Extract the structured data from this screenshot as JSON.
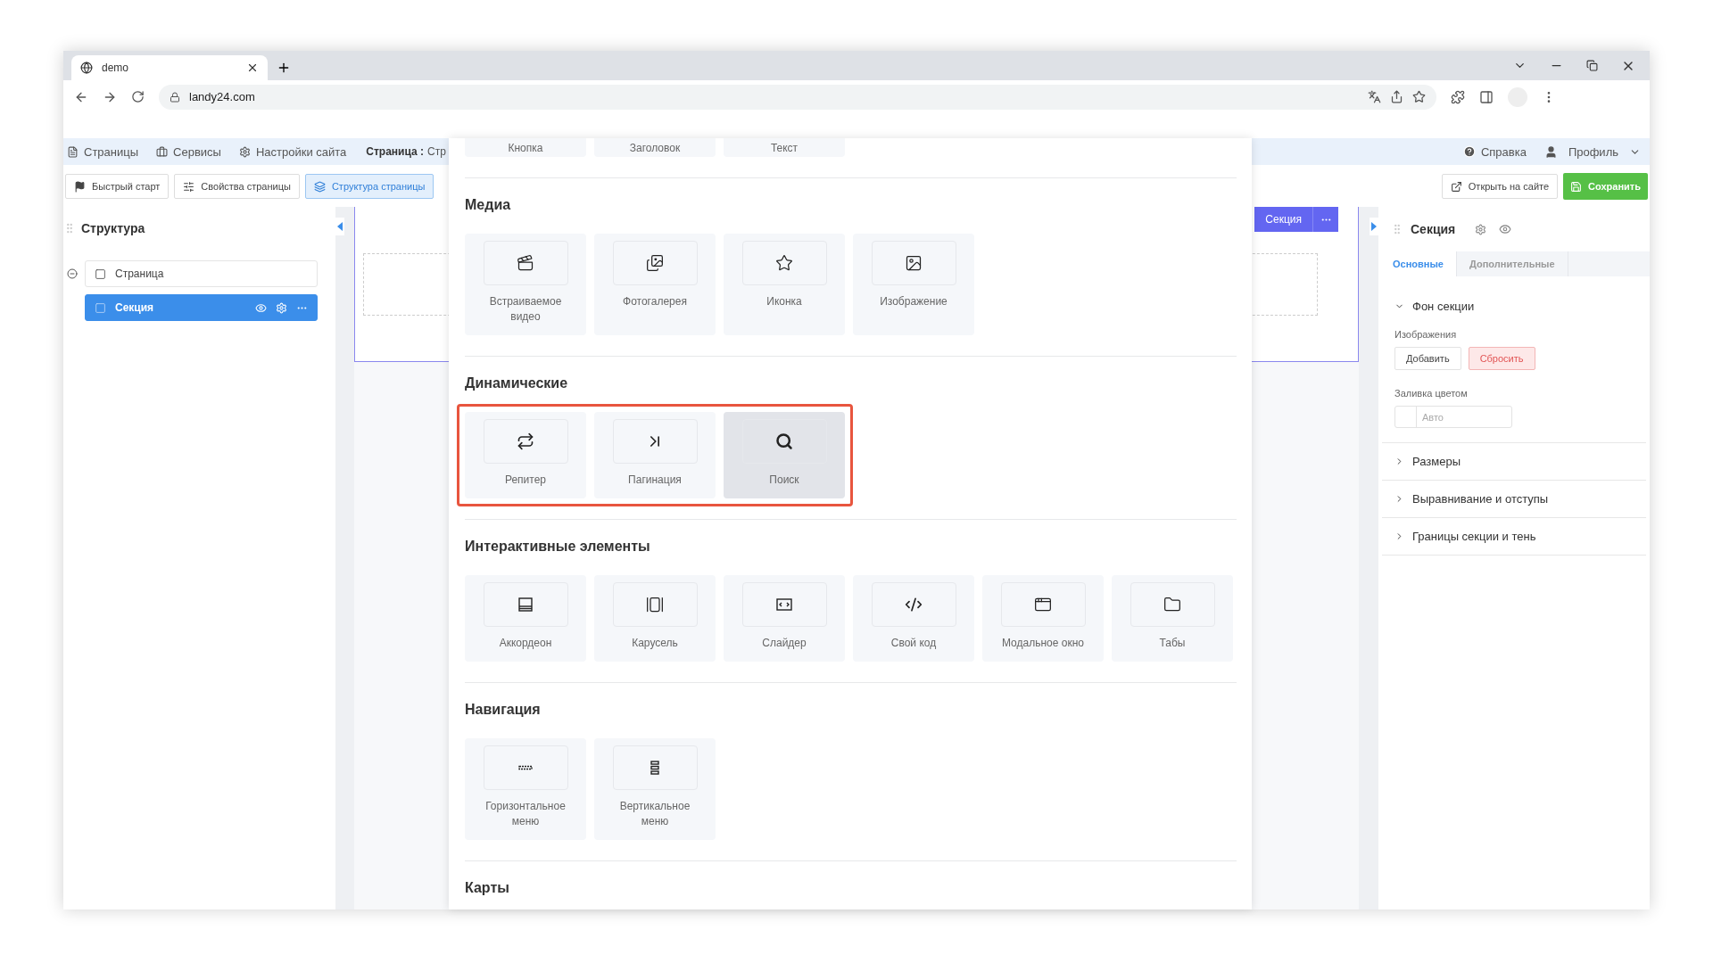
{
  "browser": {
    "tab_title": "demo",
    "url": "landy24.com"
  },
  "top_nav": {
    "items": [
      {
        "kind": "pages",
        "label": "Страницы"
      },
      {
        "kind": "services",
        "label": "Сервисы"
      },
      {
        "kind": "settings",
        "label": "Настройки сайта"
      }
    ],
    "page_label": "Страница :",
    "page_name": "Стр",
    "help": "Справка",
    "profile": "Профиль"
  },
  "toolbar": {
    "buttons": [
      {
        "kind": "flag",
        "label": "Быстрый старт",
        "selected": false
      },
      {
        "kind": "sliders",
        "label": "Свойства страницы",
        "selected": false
      },
      {
        "kind": "layers",
        "label": "Структура страницы",
        "selected": true
      }
    ],
    "open_site": "Открыть на сайте",
    "save": "Сохранить"
  },
  "structure_panel": {
    "title": "Структура",
    "tree": [
      {
        "label": "Страница",
        "selected": false,
        "expanded": true,
        "children": [
          {
            "label": "Секция",
            "selected": true
          }
        ]
      }
    ]
  },
  "canvas": {
    "section_label": "Секция"
  },
  "element_picker": {
    "sections": [
      {
        "highlighted": false,
        "cards": [
          {
            "label": "Кнопка",
            "selected": false
          },
          {
            "label": "Заголовок",
            "selected": false
          },
          {
            "label": "Текст",
            "selected": false
          }
        ]
      },
      {
        "title": "Медиа",
        "highlighted": false,
        "cards": [
          {
            "kind": "video",
            "label": "Встраиваемое видео",
            "selected": false
          },
          {
            "kind": "gallery",
            "label": "Фотогалерея",
            "selected": false
          },
          {
            "kind": "star",
            "label": "Иконка",
            "selected": false
          },
          {
            "kind": "image",
            "label": "Изображение",
            "selected": false
          }
        ]
      },
      {
        "title": "Динамические",
        "highlighted": true,
        "cards": [
          {
            "kind": "repeater",
            "label": "Репитер",
            "selected": false
          },
          {
            "kind": "pagination",
            "label": "Пагинация",
            "selected": false
          },
          {
            "kind": "search",
            "label": "Поиск",
            "selected": true
          }
        ]
      },
      {
        "title": "Интерактивные элементы",
        "highlighted": false,
        "cards": [
          {
            "kind": "accordion",
            "label": "Аккордеон",
            "selected": false
          },
          {
            "kind": "carousel",
            "label": "Карусель",
            "selected": false
          },
          {
            "kind": "slider",
            "label": "Слайдер",
            "selected": false
          },
          {
            "kind": "code",
            "label": "Свой код",
            "selected": false
          },
          {
            "kind": "modal",
            "label": "Модальное окно",
            "selected": false
          },
          {
            "kind": "tabs",
            "label": "Табы",
            "selected": false
          }
        ]
      },
      {
        "title": "Навигация",
        "highlighted": false,
        "cards": [
          {
            "kind": "hmenu",
            "label": "Горизонтальное меню",
            "selected": false
          },
          {
            "kind": "vmenu",
            "label": "Вертикальное меню",
            "selected": false
          }
        ]
      },
      {
        "title": "Карты"
      }
    ]
  },
  "properties_panel": {
    "title": "Секция",
    "tabs": [
      {
        "label": "Основные",
        "selected": true
      },
      {
        "label": "Дополнительные",
        "selected": false
      }
    ],
    "accordions": [
      {
        "title": "Фон секции",
        "expanded": true,
        "fields": [
          {
            "kind": "buttons",
            "label": "Изображения",
            "buttons": [
              {
                "kind": "default",
                "label": "Добавить"
              },
              {
                "kind": "danger",
                "label": "Сбросить"
              }
            ]
          },
          {
            "kind": "color",
            "label": "Заливка цветом",
            "placeholder": "Авто"
          }
        ]
      },
      {
        "title": "Размеры",
        "expanded": false
      },
      {
        "title": "Выравнивание и отступы",
        "expanded": false
      },
      {
        "title": "Границы секции и тень",
        "expanded": false
      }
    ]
  }
}
